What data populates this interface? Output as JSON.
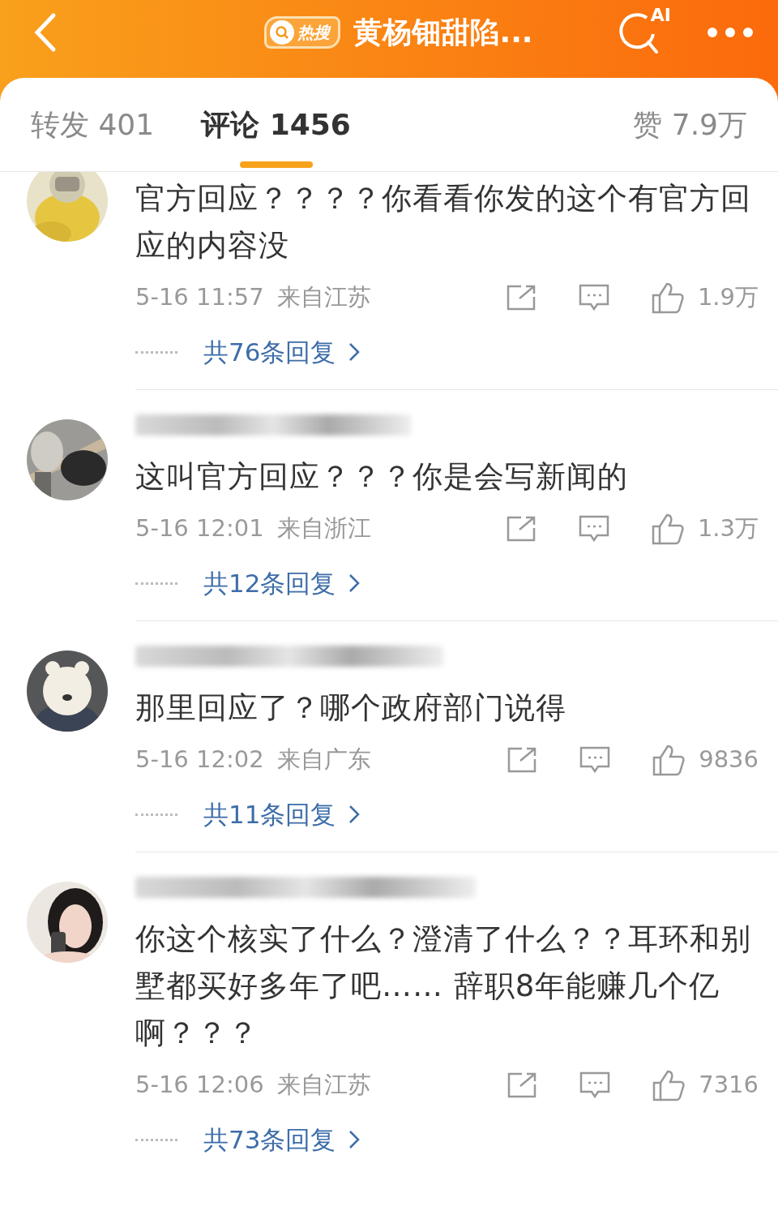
{
  "header": {
    "badge": "热搜",
    "title": "黄杨钿甜陷...",
    "ai_label": "AI"
  },
  "tabs": [
    {
      "label": "转发 401",
      "selected": false
    },
    {
      "label": "评论 1456",
      "selected": true
    }
  ],
  "likes_total": "赞 7.9万",
  "comments": [
    {
      "name_redacted": false,
      "text": "官方回应？？？？你看看你发的这个有官方回应的内容没",
      "time": "5-16 11:57",
      "location": "来自江苏",
      "likes": "1.9万",
      "replies": "共76条回复"
    },
    {
      "name_redacted": true,
      "text": "这叫官方回应？？？你是会写新闻的",
      "time": "5-16 12:01",
      "location": "来自浙江",
      "likes": "1.3万",
      "replies": "共12条回复"
    },
    {
      "name_redacted": true,
      "text": "那里回应了？哪个政府部门说得",
      "time": "5-16 12:02",
      "location": "来自广东",
      "likes": "9836",
      "replies": "共11条回复"
    },
    {
      "name_redacted": true,
      "text": "你这个核实了什么？澄清了什么？？耳环和别墅都买好多年了吧…… 辞职8年能赚几个亿啊？？？",
      "time": "5-16 12:06",
      "location": "来自江苏",
      "likes": "7316",
      "replies": "共73条回复"
    }
  ]
}
